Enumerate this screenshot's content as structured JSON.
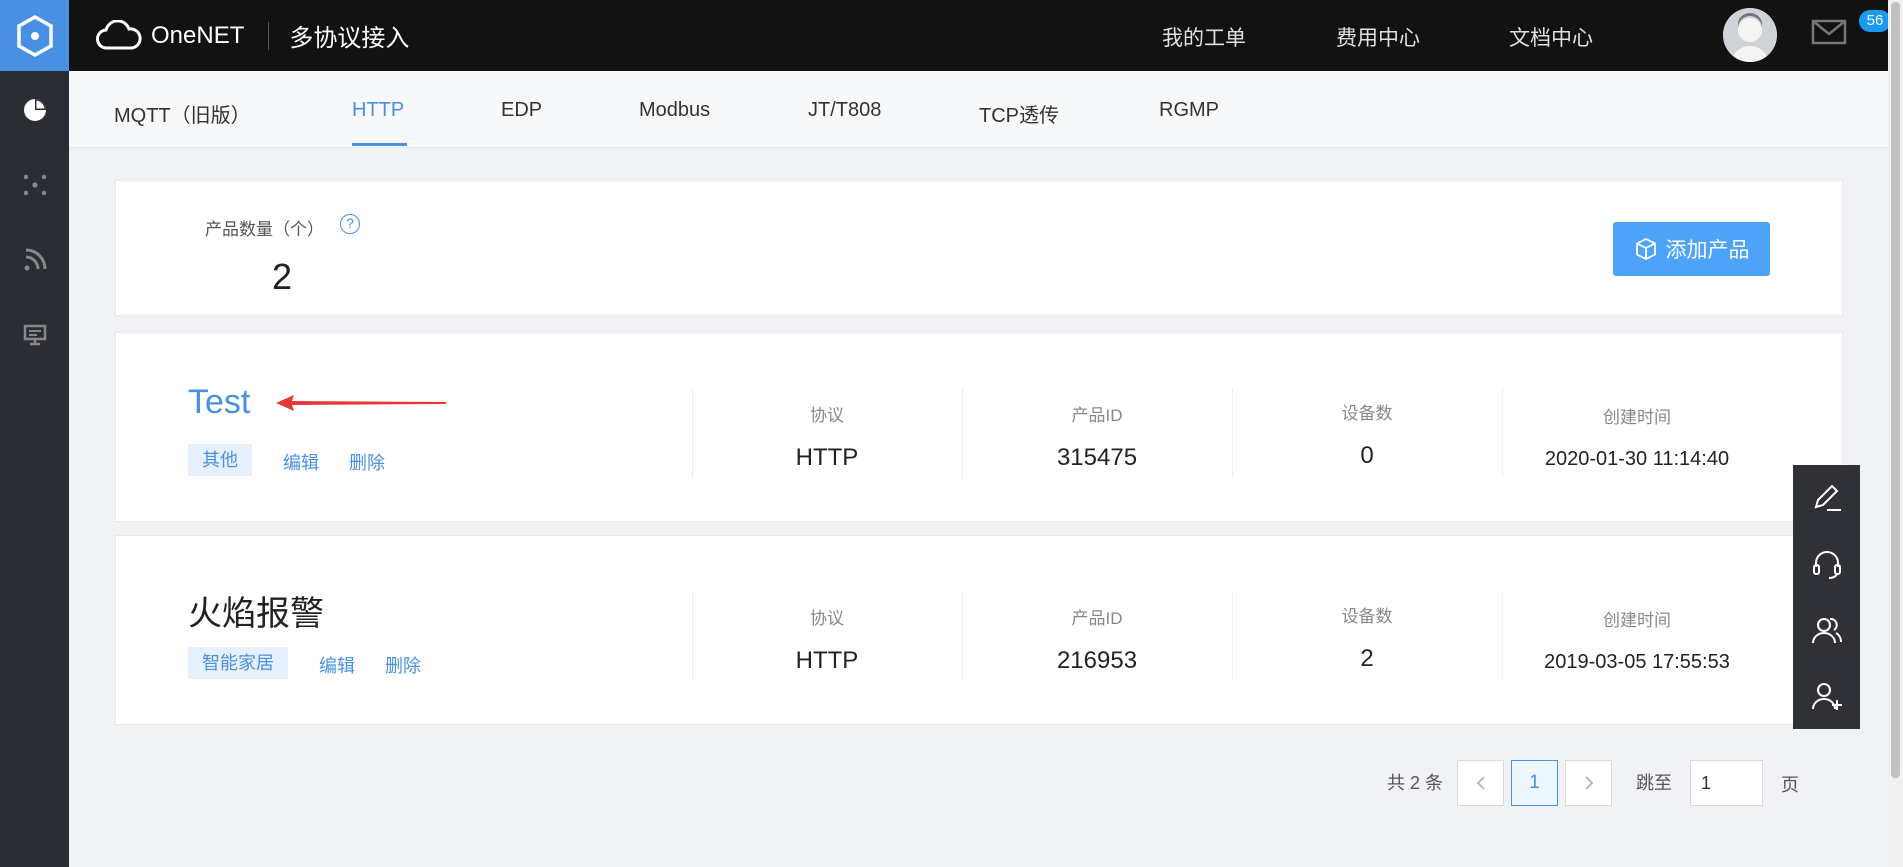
{
  "header": {
    "brand": "OneNET",
    "subtitle": "多协议接入",
    "nav": [
      "我的工单",
      "费用中心",
      "文档中心"
    ],
    "mail_badge": "56"
  },
  "sidebar": {
    "items": [
      "overview-icon",
      "devices-icon",
      "rss-icon",
      "monitor-icon"
    ]
  },
  "tabs": [
    {
      "label": "MQTT（旧版）",
      "active": false
    },
    {
      "label": "HTTP",
      "active": true
    },
    {
      "label": "EDP",
      "active": false
    },
    {
      "label": "Modbus",
      "active": false
    },
    {
      "label": "JT/T808",
      "active": false
    },
    {
      "label": "TCP透传",
      "active": false
    },
    {
      "label": "RGMP",
      "active": false
    }
  ],
  "summary": {
    "label": "产品数量（个）",
    "help": "?",
    "count": "2",
    "add_button": "添加产品"
  },
  "columns": {
    "protocol": "协议",
    "product_id": "产品ID",
    "device_count": "设备数",
    "created": "创建时间"
  },
  "products": [
    {
      "name": "Test",
      "category": "其他",
      "edit": "编辑",
      "delete": "删除",
      "protocol": "HTTP",
      "product_id": "315475",
      "device_count": "0",
      "created": "2020-01-30 11:14:40"
    },
    {
      "name": "火焰报警",
      "category": "智能家居",
      "edit": "编辑",
      "delete": "删除",
      "protocol": "HTTP",
      "product_id": "216953",
      "device_count": "2",
      "created": "2019-03-05 17:55:53"
    }
  ],
  "pagination": {
    "total_text": "共 2 条",
    "current_page": "1",
    "jump_label": "跳至",
    "jump_value": "1",
    "page_unit": "页"
  },
  "floating_tools": [
    "edit-icon",
    "customer-service-icon",
    "community-icon",
    "add-user-icon"
  ],
  "colors": {
    "accent": "#4a90e2",
    "sidebar": "#2b2d35",
    "header": "#121212",
    "annotation_arrow": "#e53935"
  }
}
